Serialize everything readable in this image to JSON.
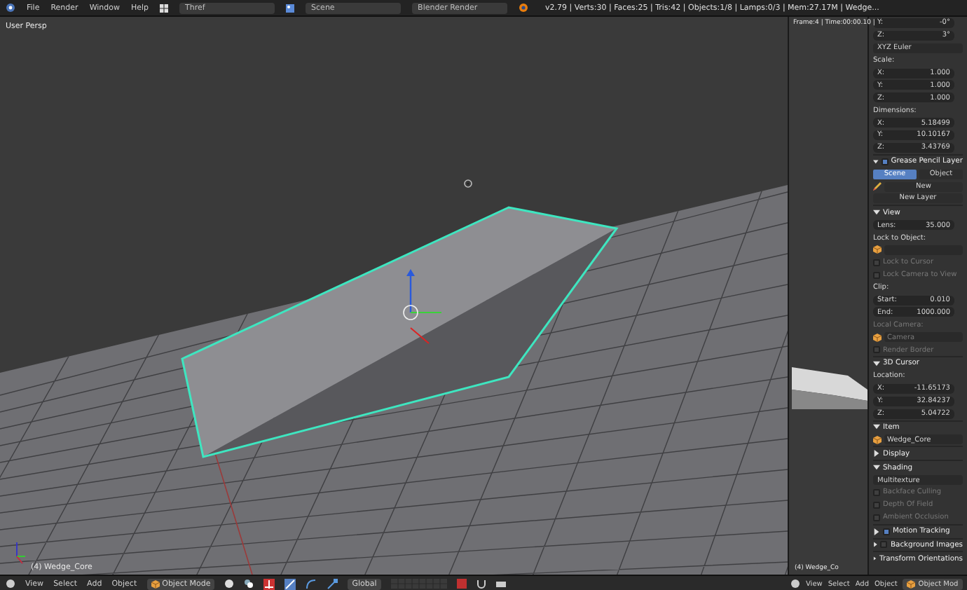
{
  "top_bar": {
    "menus": [
      "File",
      "Render",
      "Window",
      "Help"
    ],
    "screen": "Thref",
    "scene": "Scene",
    "engine": "Blender Render",
    "stats": "v2.79 | Verts:30 | Faces:25 | Tris:42 | Objects:1/8 | Lamps:0/3 | Mem:27.17M | Wedge..."
  },
  "viewport": {
    "view_label": "User Persp",
    "object_label": "(4) Wedge_Core"
  },
  "side_viewport": {
    "frame_label": "Frame:4 | Time:00:00.10 |",
    "object_label": "(4) Wedge_Co"
  },
  "properties": [
    {
      "kind": "field",
      "label": "Y:",
      "value": "-0°"
    },
    {
      "kind": "field",
      "label": "Z:",
      "value": "3°"
    },
    {
      "kind": "dropdown",
      "label": "XYZ Euler"
    },
    {
      "kind": "heading",
      "label": "Scale:"
    },
    {
      "kind": "field",
      "label": "X:",
      "value": "1.000"
    },
    {
      "kind": "field",
      "label": "Y:",
      "value": "1.000"
    },
    {
      "kind": "field",
      "label": "Z:",
      "value": "1.000"
    },
    {
      "kind": "heading",
      "label": "Dimensions:"
    },
    {
      "kind": "field",
      "label": "X:",
      "value": "5.18499"
    },
    {
      "kind": "field",
      "label": "Y:",
      "value": "10.10167"
    },
    {
      "kind": "field",
      "label": "Z:",
      "value": "3.43769"
    },
    {
      "kind": "section",
      "label": "Grease Pencil Layer",
      "expanded": true,
      "checked": true
    },
    {
      "kind": "tabs",
      "tabs": [
        {
          "label": "Scene",
          "selected": true
        },
        {
          "label": "Object",
          "selected": false
        }
      ]
    },
    {
      "kind": "new",
      "label": "New"
    },
    {
      "kind": "button",
      "label": "New Layer"
    },
    {
      "kind": "section",
      "label": "View",
      "expanded": true
    },
    {
      "kind": "field",
      "label": "Lens:",
      "value": "35.000"
    },
    {
      "kind": "heading",
      "label": "Lock to Object:"
    },
    {
      "kind": "object"
    },
    {
      "kind": "checkbox",
      "label": "Lock to Cursor",
      "checked": false,
      "disabled": true
    },
    {
      "kind": "checkbox",
      "label": "Lock Camera to View",
      "checked": false,
      "disabled": true
    },
    {
      "kind": "heading",
      "label": "Clip:"
    },
    {
      "kind": "field",
      "label": "Start:",
      "value": "0.010"
    },
    {
      "kind": "field",
      "label": "End:",
      "value": "1000.000"
    },
    {
      "kind": "heading",
      "label": "Local Camera:",
      "disabled": true
    },
    {
      "kind": "object",
      "label": "Camera",
      "disabled": true
    },
    {
      "kind": "checkbox",
      "label": "Render Border",
      "checked": false,
      "disabled": true
    },
    {
      "kind": "section",
      "label": "3D Cursor",
      "expanded": true
    },
    {
      "kind": "heading",
      "label": "Location:"
    },
    {
      "kind": "field",
      "label": "X:",
      "value": "-11.65173"
    },
    {
      "kind": "field",
      "label": "Y:",
      "value": "32.84237"
    },
    {
      "kind": "field",
      "label": "Z:",
      "value": "5.04722"
    },
    {
      "kind": "section",
      "label": "Item",
      "expanded": true
    },
    {
      "kind": "object",
      "label": "Wedge_Core"
    },
    {
      "kind": "section",
      "label": "Display",
      "expanded": false
    },
    {
      "kind": "section",
      "label": "Shading",
      "expanded": true
    },
    {
      "kind": "dropdown",
      "label": "Multitexture"
    },
    {
      "kind": "checkbox",
      "label": "Backface Culling",
      "checked": false,
      "disabled": true
    },
    {
      "kind": "checkbox",
      "label": "Depth Of Field",
      "checked": false,
      "disabled": true
    },
    {
      "kind": "checkbox",
      "label": "Ambient Occlusion",
      "checked": false,
      "disabled": true
    },
    {
      "kind": "section",
      "label": "Motion Tracking",
      "expanded": false,
      "checked": true
    },
    {
      "kind": "section",
      "label": "Background Images",
      "expanded": false,
      "checked": false
    },
    {
      "kind": "section",
      "label": "Transform Orientations",
      "expanded": false
    }
  ],
  "bottom_bar": {
    "menus": [
      "View",
      "Select",
      "Add",
      "Object"
    ],
    "mode": "Object Mode",
    "orientation": "Global"
  },
  "side_bottom_bar": {
    "menus": [
      "View",
      "Select",
      "Add",
      "Object"
    ],
    "mode": "Object Mod"
  }
}
